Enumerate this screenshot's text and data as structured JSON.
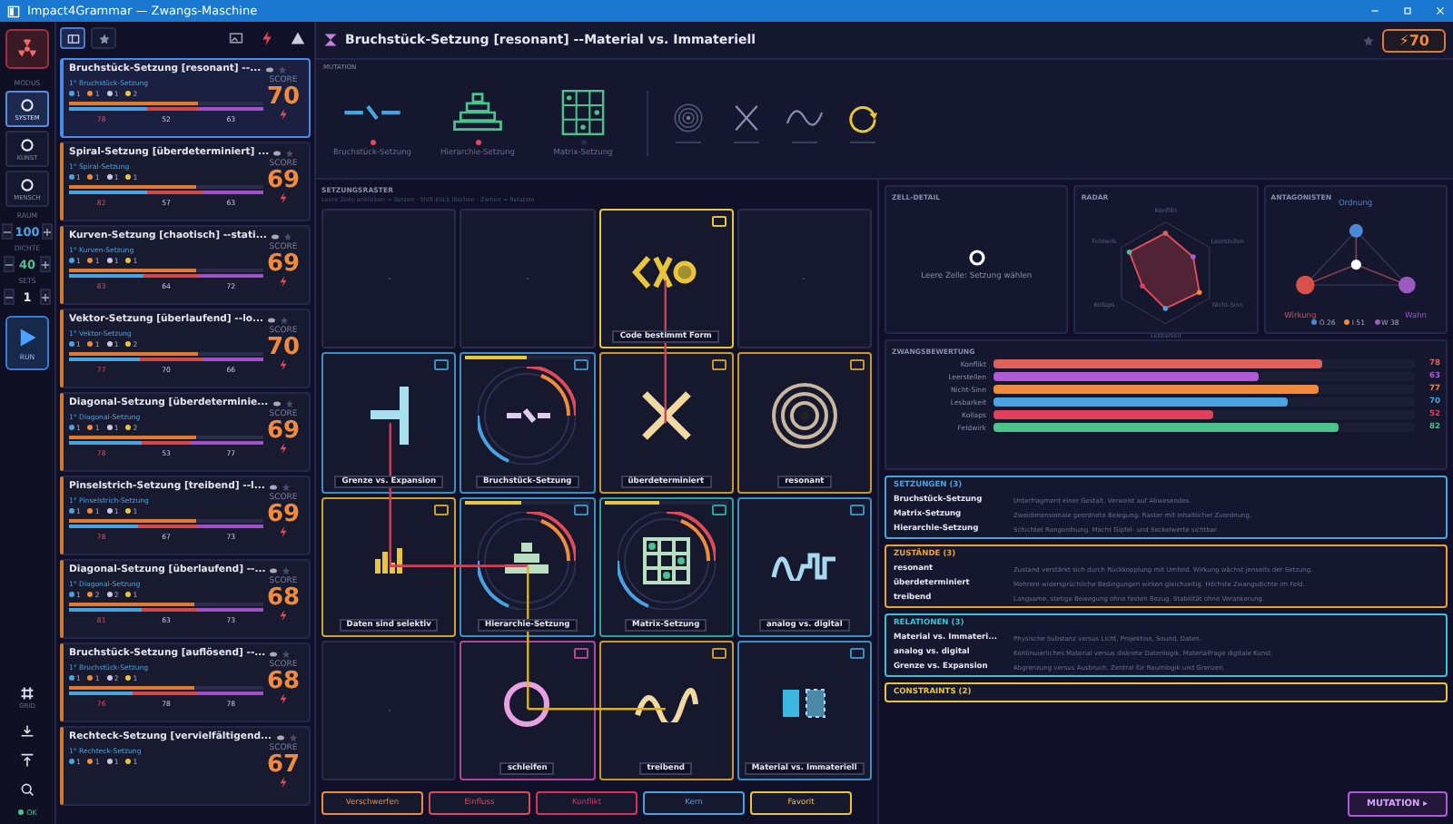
{
  "window": {
    "title": "Impact4Grammar — Zwangs-Maschine"
  },
  "rail": {
    "mode_label": "MODUS",
    "modes": [
      {
        "label": "SYSTEM",
        "selected": true
      },
      {
        "label": "KUNST",
        "selected": false
      },
      {
        "label": "MENSCH",
        "selected": false
      }
    ],
    "steppers": [
      {
        "label": "RAUM",
        "value": "100",
        "color": "#4aa3e0"
      },
      {
        "label": "DICHTE",
        "value": "40",
        "color": "#4cc38a"
      },
      {
        "label": "SETS",
        "value": "1",
        "color": "#e6e6f0"
      }
    ],
    "run": "RUN",
    "grid_label": "GRID",
    "status": "OK"
  },
  "cards": [
    {
      "title": "Bruchstück-Setzung [resonant] --...",
      "sub": "1° Bruchstück-Setzung",
      "counts": [
        "1",
        "1",
        "1",
        "2"
      ],
      "nums": [
        "78",
        "52",
        "63"
      ],
      "score": "70",
      "score_label": "SCORE",
      "selected": true
    },
    {
      "title": "Spiral-Setzung [überdeterminiert] ...",
      "sub": "1° Spiral-Setzung",
      "counts": [
        "1",
        "1",
        "1",
        "1"
      ],
      "nums": [
        "82",
        "57",
        "63"
      ],
      "score": "69",
      "score_label": "SCORE",
      "selected": false
    },
    {
      "title": "Kurven-Setzung [chaotisch] --stati...",
      "sub": "1° Kurven-Setzung",
      "counts": [
        "1",
        "1",
        "1",
        "1"
      ],
      "nums": [
        "83",
        "64",
        "72"
      ],
      "score": "69",
      "score_label": "SCORE",
      "selected": false
    },
    {
      "title": "Vektor-Setzung [überlaufend] --lo...",
      "sub": "1° Vektor-Setzung",
      "counts": [
        "1",
        "1",
        "1",
        "2"
      ],
      "nums": [
        "77",
        "70",
        "66"
      ],
      "score": "70",
      "score_label": "SCORE",
      "selected": false
    },
    {
      "title": "Diagonal-Setzung [überdeterminie...",
      "sub": "1° Diagonal-Setzung",
      "counts": [
        "1",
        "1",
        "1",
        "2"
      ],
      "nums": [
        "78",
        "53",
        "77"
      ],
      "score": "69",
      "score_label": "SCORE",
      "selected": false
    },
    {
      "title": "Pinselstrich-Setzung [treibend] --l...",
      "sub": "1° Pinselstrich-Setzung",
      "counts": [
        "1",
        "1",
        "1",
        "1"
      ],
      "nums": [
        "78",
        "67",
        "73"
      ],
      "score": "69",
      "score_label": "SCORE",
      "selected": false
    },
    {
      "title": "Diagonal-Setzung [überlaufend] --...",
      "sub": "1° Diagonal-Setzung",
      "counts": [
        "1",
        "2",
        "2",
        "1"
      ],
      "nums": [
        "81",
        "63",
        "73"
      ],
      "score": "68",
      "score_label": "SCORE",
      "selected": false
    },
    {
      "title": "Bruchstück-Setzung [auflösend] --...",
      "sub": "1° Bruchstück-Setzung",
      "counts": [
        "1",
        "1",
        "2",
        "1"
      ],
      "nums": [
        "76",
        "78",
        "78"
      ],
      "score": "68",
      "score_label": "SCORE",
      "selected": false
    },
    {
      "title": "Rechteck-Setzung [vervielfältigend...",
      "sub": "1° Rechteck-Setzung",
      "counts": [
        "1",
        "1",
        "1",
        "1"
      ],
      "score": "67",
      "score_label": "SCORE",
      "selected": false
    }
  ],
  "header": {
    "title": "Bruchstück-Setzung [resonant] --Material vs. Immateriell",
    "score": "⚡70"
  },
  "mutation": {
    "label": "MUTATION",
    "items": [
      {
        "kind": "fragment",
        "label": "Bruchstück-Setzung",
        "marked": true
      },
      {
        "kind": "hierarchy",
        "label": "Hierarchie-Setzung",
        "marked": true
      },
      {
        "kind": "matrix",
        "label": "Matrix-Setzung",
        "marked": false
      }
    ],
    "options": [
      {
        "kind": "target"
      },
      {
        "kind": "cross"
      },
      {
        "kind": "wave"
      },
      {
        "kind": "cycle"
      }
    ]
  },
  "grid": {
    "title": "SETZUNGSRASTER",
    "hint": "Leere Zelle anklicken → Setzen · Shift-Klick löschen · Ziehen = Relation",
    "cells": [
      {
        "kind": "empty"
      },
      {
        "kind": "empty"
      },
      {
        "kind": "code",
        "label": "Code bestimmt Form",
        "color": "#e8c53a"
      },
      {
        "kind": "empty"
      },
      {
        "kind": "barrier",
        "label": "Grenze vs. Expansion",
        "color": "#3a8fc0"
      },
      {
        "kind": "fragment",
        "label": "Bruchstück-Setzung",
        "color": "#3a8fc0",
        "level": 0.5
      },
      {
        "kind": "cross",
        "label": "überdeterminiert",
        "color": "#c8962a"
      },
      {
        "kind": "target",
        "label": "resonant",
        "color": "#c8962a"
      },
      {
        "kind": "bars",
        "label": "Daten sind selektiv",
        "color": "#c8a22a"
      },
      {
        "kind": "hierarchy",
        "label": "Hierarchie-Setzung",
        "color": "#3a8fc0",
        "level": 0.45
      },
      {
        "kind": "matrix",
        "label": "Matrix-Setzung",
        "color": "#2aa39a",
        "level": 0.45
      },
      {
        "kind": "digital",
        "label": "analog vs. digital",
        "color": "#3a8fc0"
      },
      {
        "kind": "empty"
      },
      {
        "kind": "ring",
        "label": "schleifen",
        "color": "#b0489a"
      },
      {
        "kind": "wave",
        "label": "treibend",
        "color": "#c8962a"
      },
      {
        "kind": "squares",
        "label": "Material vs. Immateriell",
        "color": "#3a8fc0"
      }
    ],
    "actions": [
      {
        "label": "Verschwerfen",
        "color": "#f08a3c"
      },
      {
        "label": "Einfluss",
        "color": "#e04a5a"
      },
      {
        "label": "Konflikt",
        "color": "#e0305a"
      },
      {
        "label": "Kern",
        "color": "#4aa3e0"
      },
      {
        "label": "Favorit",
        "color": "#e8c53a"
      }
    ]
  },
  "detail": {
    "title": "ZELL-DETAIL",
    "text": "Leere Zelle: Setzung wählen"
  },
  "radar": {
    "title": "RADAR",
    "axes": [
      "Konflikt",
      "Leerstellen",
      "Nicht-Sinn",
      "Lesbarkeit",
      "Kollaps",
      "Feldwirk"
    ]
  },
  "antagonists": {
    "title": "ANTAGONISTEN",
    "nodes": [
      {
        "label": "Ordnung",
        "color": "#4a8ad8"
      },
      {
        "label": "Wirkung",
        "color": "#d8504a"
      },
      {
        "label": "Wahn",
        "color": "#9a5ac0"
      }
    ],
    "legend": [
      {
        "text": "O 26",
        "color": "#4a8ad8"
      },
      {
        "text": "I 51",
        "color": "#f08a3c"
      },
      {
        "text": "W 38",
        "color": "#9a5ac0"
      }
    ]
  },
  "scores": {
    "title": "ZWANGSBEWERTUNG",
    "rows": [
      {
        "label": "Konflikt",
        "level": 0.78,
        "reading": "78",
        "color": "#e0605a"
      },
      {
        "label": "Leerstellen",
        "level": 0.63,
        "reading": "63",
        "color": "#b05ad8"
      },
      {
        "label": "Nicht-Sinn",
        "level": 0.77,
        "reading": "77",
        "color": "#f08a3c"
      },
      {
        "label": "Lesbarkeit",
        "level": 0.7,
        "reading": "70",
        "color": "#4aa3e0"
      },
      {
        "label": "Kollaps",
        "level": 0.52,
        "reading": "52",
        "color": "#e0405a"
      },
      {
        "label": "Feldwirk",
        "level": 0.82,
        "reading": "82",
        "color": "#4cc38a"
      }
    ]
  },
  "sections": [
    {
      "title": "SETZUNGEN (3)",
      "color": "#4aa3e0",
      "items": [
        {
          "name": "Bruchstück-Setzung",
          "text": "Unterfragment einer Gestalt. Verweist auf Abwesendes."
        },
        {
          "name": "Matrix-Setzung",
          "text": "Zweidimensionale geordnete Belegung. Raster mit inhaltlicher Zuordnung."
        },
        {
          "name": "Hierarchie-Setzung",
          "text": "Schichtet Rangordnung. Macht Gipfel- und Sockelwerte sichtbar."
        }
      ]
    },
    {
      "title": "ZUSTÄNDE (3)",
      "color": "#e8a23a",
      "items": [
        {
          "name": "resonant",
          "text": "Zustand verstärkt sich durch Rückkopplung mit Umfeld. Wirkung wächst jenseits der Setzung."
        },
        {
          "name": "überdeterminiert",
          "text": "Mehrere widersprüchliche Bedingungen wirken gleichzeitig. Höchste Zwangsdichte im Feld."
        },
        {
          "name": "treibend",
          "text": "Langsame, stetige Bewegung ohne festen Bezug. Stabilität ohne Verankerung."
        }
      ]
    },
    {
      "title": "RELATIONEN (3)",
      "color": "#3ac0d0",
      "items": [
        {
          "name": "Material vs. Immateri...",
          "text": "Physische Substanz versus Licht, Projektion, Sound, Daten."
        },
        {
          "name": "analog vs. digital",
          "text": "Kontinuierliches Material versus diskrete Datenlogik. Materialfrage digitale Kunst."
        },
        {
          "name": "Grenze vs. Expansion",
          "text": "Abgrenzung versus Ausbruch. Zentral für Raumlogik und Grenzen."
        }
      ]
    },
    {
      "title": "CONSTRAINTS (2)",
      "color": "#e8c53a"
    }
  ],
  "mutate_button": "MUTATION ▸"
}
